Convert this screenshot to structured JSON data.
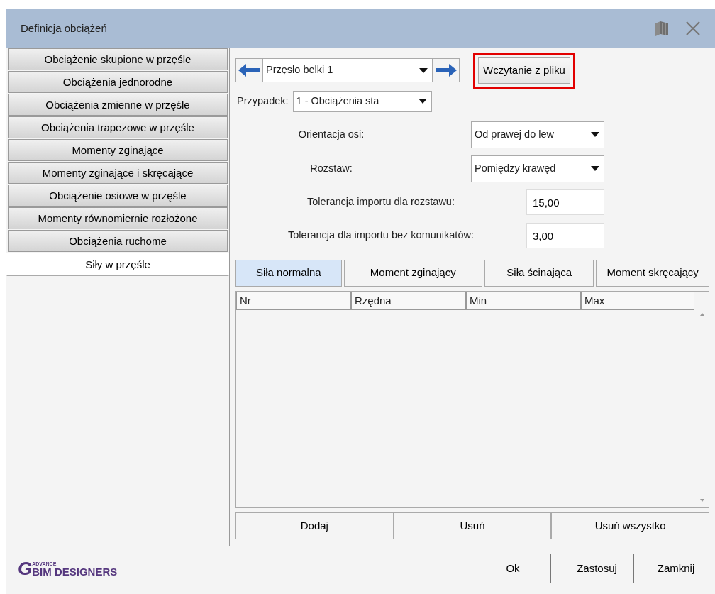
{
  "window": {
    "title": "Definicja obciążeń"
  },
  "side_tabs": [
    {
      "label": "Obciążenie skupione w przęśle",
      "selected": false
    },
    {
      "label": "Obciążenia jednorodne",
      "selected": false
    },
    {
      "label": "Obciążenia zmienne w przęśle",
      "selected": false
    },
    {
      "label": "Obciążenia trapezowe w przęśle",
      "selected": false
    },
    {
      "label": "Momenty zginające",
      "selected": false
    },
    {
      "label": "Momenty zginające i skręcające",
      "selected": false
    },
    {
      "label": "Obciążenie osiowe w przęśle",
      "selected": false
    },
    {
      "label": "Momenty równomiernie rozłożone",
      "selected": false
    },
    {
      "label": "Obciążenia ruchome",
      "selected": false
    },
    {
      "label": "Siły w przęśle",
      "selected": true
    }
  ],
  "span_selector": {
    "value": "Przęsło belki 1"
  },
  "load_file_button": {
    "label": "Wczytanie z pliku",
    "highlighted": true
  },
  "case": {
    "label": "Przypadek:",
    "value": "1 - Obciążenia sta"
  },
  "fields": [
    {
      "kind": "select",
      "label": "Orientacja osi:",
      "value": "Od prawej do lew"
    },
    {
      "kind": "select",
      "label": "Rozstaw:",
      "value": "Pomiędzy krawęd"
    },
    {
      "kind": "input",
      "label": "Tolerancja importu dla rozstawu:",
      "value": "15,00"
    },
    {
      "kind": "input",
      "label": "Tolerancja dla importu bez komunikatów:",
      "value": "3,00"
    }
  ],
  "inner_tabs": [
    {
      "label": "Siła normalna",
      "selected": true
    },
    {
      "label": "Moment zginający",
      "selected": false
    },
    {
      "label": "Siła ścinająca",
      "selected": false
    },
    {
      "label": "Moment skręcający",
      "selected": false
    }
  ],
  "table": {
    "columns": [
      "Nr",
      "Rzędna",
      "Min",
      "Max"
    ]
  },
  "table_buttons": [
    "Dodaj",
    "Usuń",
    "Usuń wszystko"
  ],
  "logo": {
    "mark": "G",
    "top": "ADVANCE",
    "name": "BIM DESIGNERS"
  },
  "buttons": [
    "Ok",
    "Zastosuj",
    "Zamknij"
  ]
}
